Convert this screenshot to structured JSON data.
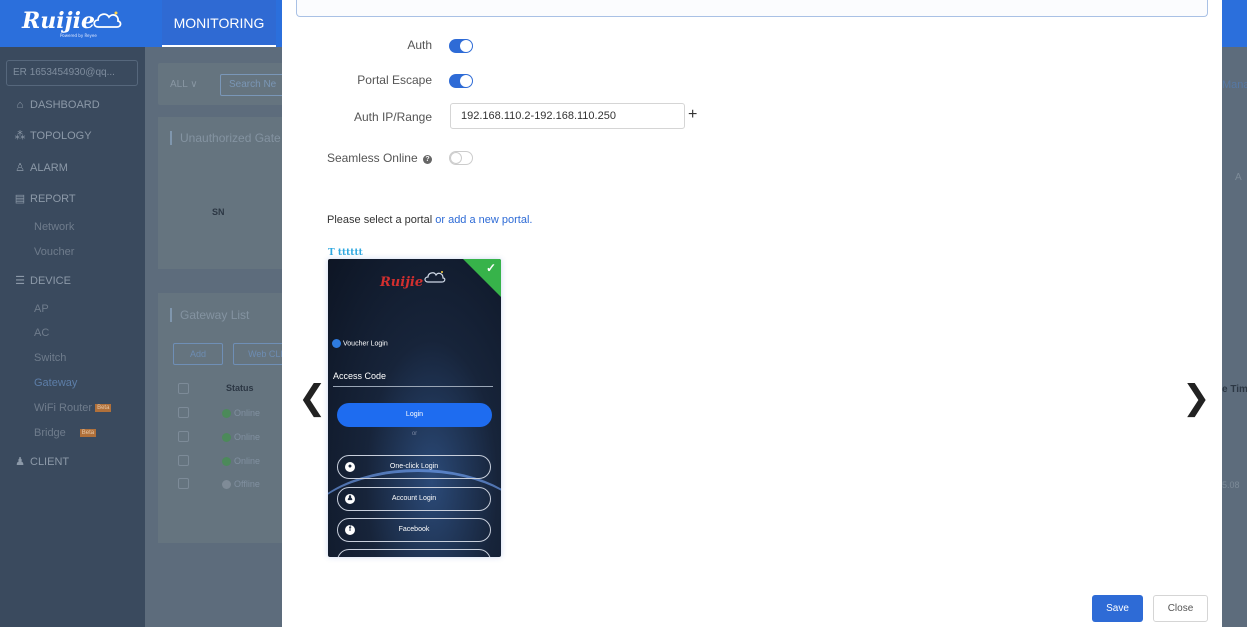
{
  "app": {
    "logo_text": "Ruijie",
    "logo_sub": "Powered by Reyee",
    "nav_monitoring": "MONITORING"
  },
  "sidebar": {
    "account": "1653454930@qq...",
    "account_initials": "ER",
    "items": [
      {
        "label": "DASHBOARD",
        "icon": "dashboard-icon"
      },
      {
        "label": "TOPOLOGY",
        "icon": "topology-icon"
      },
      {
        "label": "ALARM",
        "icon": "alarm-icon"
      },
      {
        "label": "REPORT",
        "icon": "report-icon"
      },
      {
        "label": "Network"
      },
      {
        "label": "Voucher"
      },
      {
        "label": "DEVICE",
        "icon": "device-icon"
      },
      {
        "label": "AP"
      },
      {
        "label": "AC"
      },
      {
        "label": "Switch"
      },
      {
        "label": "Gateway"
      },
      {
        "label": "WiFi Router",
        "badge": "Beta"
      },
      {
        "label": "Bridge",
        "badge": "Beta"
      },
      {
        "label": "CLIENT",
        "icon": "client-icon"
      }
    ]
  },
  "background": {
    "filter_all": "ALL",
    "search_placeholder": "Search Ne",
    "panel1_title": "Unauthorized Gate",
    "sn_header": "SN",
    "panel2_title": "Gateway List",
    "add_button": "Add",
    "webcli_button": "Web CLI",
    "status_header": "Status",
    "rows": [
      "Online",
      "Online",
      "Online",
      "Offline"
    ],
    "right_manage": "Mana",
    "right_a": "A",
    "right_time": "e Tim",
    "right_date": "5.08"
  },
  "modal": {
    "auth_label": "Auth",
    "auth_on": true,
    "portal_escape_label": "Portal Escape",
    "portal_escape_on": true,
    "auth_ip_label": "Auth IP/Range",
    "auth_ip_value": "192.168.110.2-192.168.110.250",
    "add_symbol": "+",
    "seamless_label": "Seamless Online",
    "seamless_on": false,
    "select_portal_text": "Please select a portal",
    "add_portal_link": "or add a new portal.",
    "portal_name": "T tttttt",
    "prev_arrow": "❮",
    "next_arrow": "❯",
    "save_label": "Save",
    "close_label": "Close"
  },
  "portal_card": {
    "logo": "Ruijie",
    "voucher_login": "Voucher Login",
    "access_code": "Access Code",
    "login_button": "Login",
    "or": "or",
    "one_click": "One-click Login",
    "account_login": "Account Login",
    "facebook": "Facebook"
  },
  "colors": {
    "primary": "#2e6bd6",
    "topbar": "#2b6fdc",
    "sidebar_overlay": "#3a4a5e",
    "selected_green": "#37b34a"
  }
}
